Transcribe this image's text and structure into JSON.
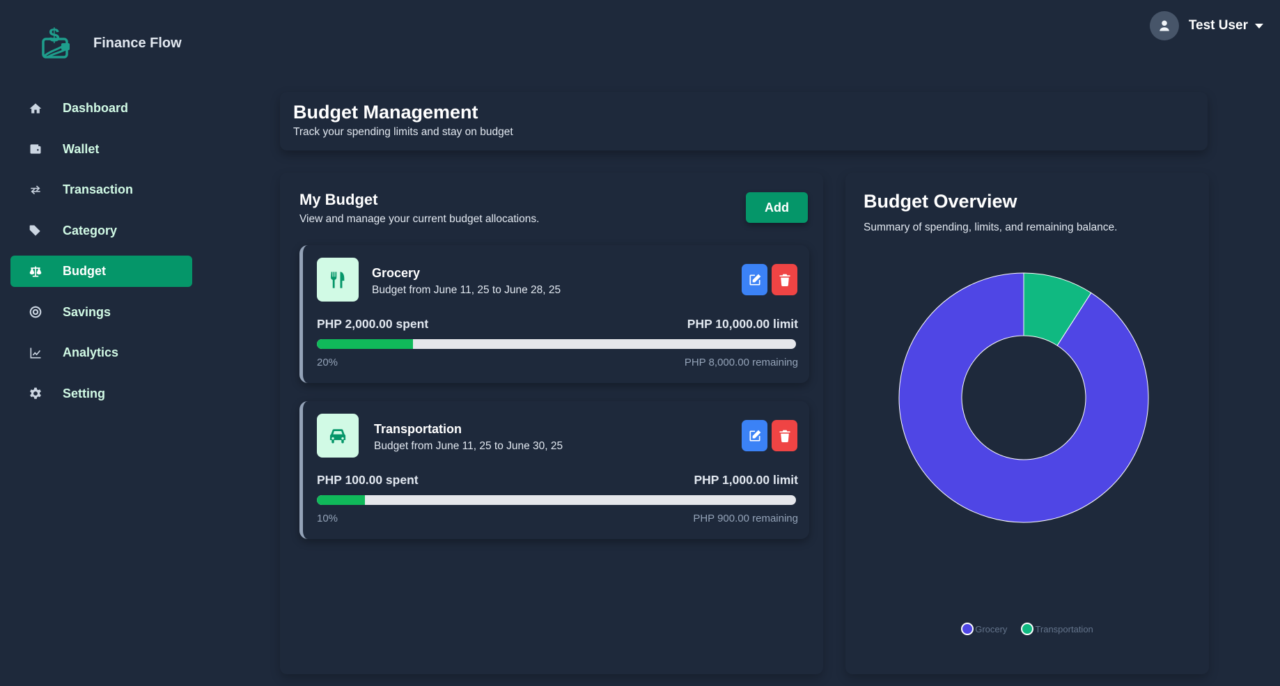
{
  "app": {
    "name": "Finance Flow"
  },
  "user": {
    "name": "Test User"
  },
  "sidebar": {
    "items": [
      {
        "label": "Dashboard",
        "icon": "home-icon",
        "active": false
      },
      {
        "label": "Wallet",
        "icon": "wallet-icon",
        "active": false
      },
      {
        "label": "Transaction",
        "icon": "arrows-exchange-icon",
        "active": false
      },
      {
        "label": "Category",
        "icon": "tags-icon",
        "active": false
      },
      {
        "label": "Budget",
        "icon": "scale-icon",
        "active": true
      },
      {
        "label": "Savings",
        "icon": "target-icon",
        "active": false
      },
      {
        "label": "Analytics",
        "icon": "chart-line-icon",
        "active": false
      },
      {
        "label": "Setting",
        "icon": "gear-icon",
        "active": false
      }
    ]
  },
  "header": {
    "title": "Budget Management",
    "subtitle": "Track your spending limits and stay on budget"
  },
  "budget_panel": {
    "title": "My Budget",
    "subtitle": "View and manage your current budget allocations.",
    "add_label": "Add",
    "budgets": [
      {
        "name": "Grocery",
        "icon": "utensils-icon",
        "range": "Budget from June 11, 25 to June 28, 25",
        "spent": "PHP 2,000.00 spent",
        "limit": "PHP 10,000.00 limit",
        "progress": 0.2,
        "percent_label": "20%",
        "remaining": "PHP 8,000.00 remaining"
      },
      {
        "name": "Transportation",
        "icon": "car-icon",
        "range": "Budget from June 11, 25 to June 30, 25",
        "spent": "PHP 100.00 spent",
        "limit": "PHP 1,000.00 limit",
        "progress": 0.1,
        "percent_label": "10%",
        "remaining": "PHP 900.00 remaining"
      }
    ]
  },
  "overview": {
    "title": "Budget Overview",
    "subtitle": "Summary of spending, limits, and remaining balance."
  },
  "colors": {
    "accent": "#059669",
    "grocery": "#4f46e5",
    "transportation": "#10b981",
    "edit": "#3b82f6",
    "delete": "#ef4444",
    "progress": "#10b95a"
  },
  "chart_data": {
    "type": "pie",
    "donut": true,
    "categories": [
      "Grocery",
      "Transportation"
    ],
    "values": [
      10000,
      1000
    ],
    "legend_position": "bottom"
  }
}
